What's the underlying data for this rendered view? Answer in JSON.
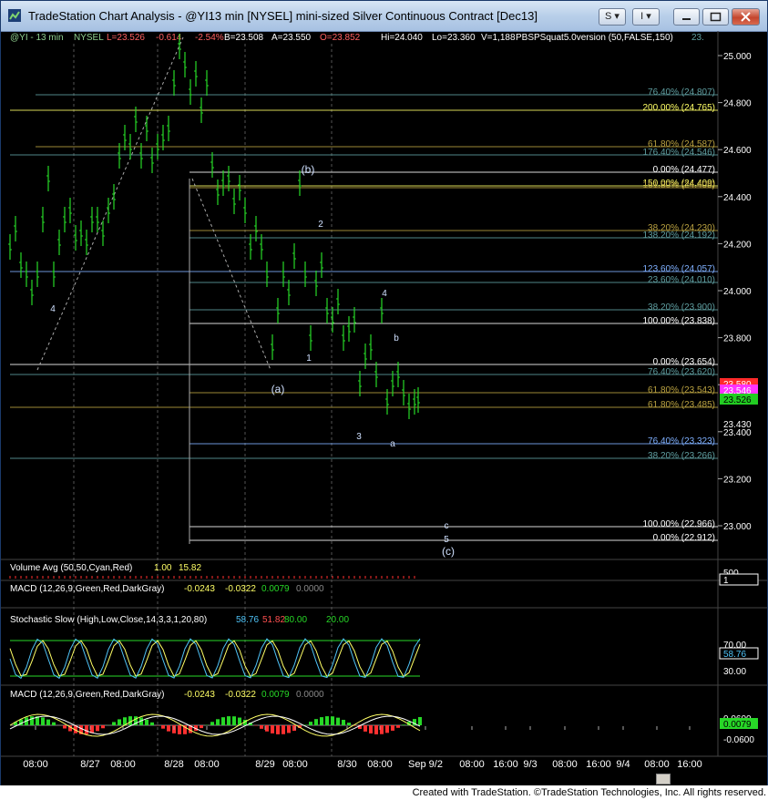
{
  "window": {
    "title": "TradeStation Chart Analysis - @YI13 min [NYSEL] mini-sized Silver Continuous Contract [Dec13]",
    "btn_s": "S ▾",
    "btn_i": "I ▾"
  },
  "header": {
    "symbol": "@YI - 13 min",
    "exchange": "NYSEL",
    "last": "L=23.526",
    "change": "-0.614",
    "pct": "-2.54%",
    "bid": "B=23.508",
    "ask": "A=23.550",
    "open": "O=23.852",
    "high": "Hi=24.040",
    "low": "Lo=23.360",
    "volume": "V=1,188",
    "study": "PBSPSquat5.0version (50,FALSE,150)",
    "study_val": "23.",
    "colors": {
      "symbol": "#8ecf8e",
      "last": "#ff6060",
      "neutral": "#ffffff"
    }
  },
  "price_axis": {
    "ticks": [
      "25.000",
      "24.800",
      "24.600",
      "24.400",
      "24.200",
      "24.000",
      "23.800",
      "23.600",
      "23.400",
      "23.200",
      "23.000"
    ],
    "tags": [
      {
        "label": "23.580",
        "bg": "#ff2a2a",
        "fg": "#ffffff"
      },
      {
        "label": "23.546",
        "bg": "#ff33ff",
        "fg": "#ffffff"
      },
      {
        "label": "23.526",
        "bg": "#22cc22",
        "fg": "#000000"
      },
      {
        "label": "23.430",
        "bg": "#000000",
        "fg": "#ffffff"
      }
    ]
  },
  "fib_lines": [
    {
      "label": "76.40% (24.807)",
      "color": "#5f9ea0"
    },
    {
      "label": "200.00% (24.765)",
      "color": "#ffff66"
    },
    {
      "label": "61.80% (24.587)",
      "color": "#b8a040"
    },
    {
      "label": "176.40% (24.546)",
      "color": "#5f9ea0"
    },
    {
      "label": "0.00% (24.477)",
      "color": "#ffffff"
    },
    {
      "label": "150.00% (24.409)",
      "color": "#ffff66"
    },
    {
      "label": "161.80% (24.409)",
      "color": "#b8a040"
    },
    {
      "label": "38.20% (24.230)",
      "color": "#b8a040"
    },
    {
      "label": "138.20% (24.192)",
      "color": "#5f9ea0"
    },
    {
      "label": "123.60% (24.057)",
      "color": "#7fb0ff"
    },
    {
      "label": "23.60% (24.010)",
      "color": "#5f9ea0"
    },
    {
      "label": "38.20% (23.900)",
      "color": "#5f9ea0"
    },
    {
      "label": "100.00% (23.838)",
      "color": "#ffffff"
    },
    {
      "label": "0.00% (23.654)",
      "color": "#ffffff"
    },
    {
      "label": "76.40% (23.620)",
      "color": "#5f9ea0"
    },
    {
      "label": "61.80% (23.543)",
      "color": "#b8a040"
    },
    {
      "label": "61.80% (23.485)",
      "color": "#b8a040"
    },
    {
      "label": "76.40% (23.323)",
      "color": "#7fb0ff"
    },
    {
      "label": "38.20% (23.266)",
      "color": "#5f9ea0"
    },
    {
      "label": "100.00% (22.966)",
      "color": "#ffffff"
    },
    {
      "label": "0.00% (22.912)",
      "color": "#ffffff"
    }
  ],
  "wave_labels": [
    "(b)",
    "2",
    "4",
    "(a)",
    "1",
    "b",
    "3",
    "a",
    "c",
    "5",
    "(c)"
  ],
  "wave_labels_small": [
    "4"
  ],
  "volume_panel": {
    "label": "Volume Avg (50,50,Cyan,Red)",
    "v1": "1.00",
    "v2": "15.82",
    "ticks": [
      "500"
    ],
    "tag": "1"
  },
  "macd_panel": {
    "label": "MACD (12,26,9,Green,Red,DarkGray)",
    "v1": "-0.0243",
    "v2": "-0.0322",
    "v3": "0.0079",
    "v4": "0.0000"
  },
  "stoch_panel": {
    "label": "Stochastic Slow (High,Low,Close,14,3,3,1,20,80)",
    "v1": "58.76",
    "v2": "51.82",
    "v3": "80.00",
    "v4": "20.00",
    "ticks": [
      "70.00",
      "30.00"
    ],
    "tag": "58.76"
  },
  "macd2_panel": {
    "label": "MACD (12,26,9,Green,Red,DarkGray)",
    "v1": "-0.0243",
    "v2": "-0.0322",
    "v3": "0.0079",
    "v4": "0.0000",
    "ticks": [
      "0.0600",
      "-0.0600"
    ],
    "tag": "0.0079"
  },
  "time_axis": [
    "08:00",
    "8/27",
    "08:00",
    "8/28",
    "08:00",
    "8/29",
    "08:00",
    "8/30",
    "08:00",
    "Sep 9/2",
    "08:00",
    "16:00",
    "9/3",
    "08:00",
    "16:00",
    "9/4",
    "08:00",
    "16:00"
  ],
  "footer": "Created with TradeStation. ©TradeStation Technologies, Inc. All rights reserved."
}
